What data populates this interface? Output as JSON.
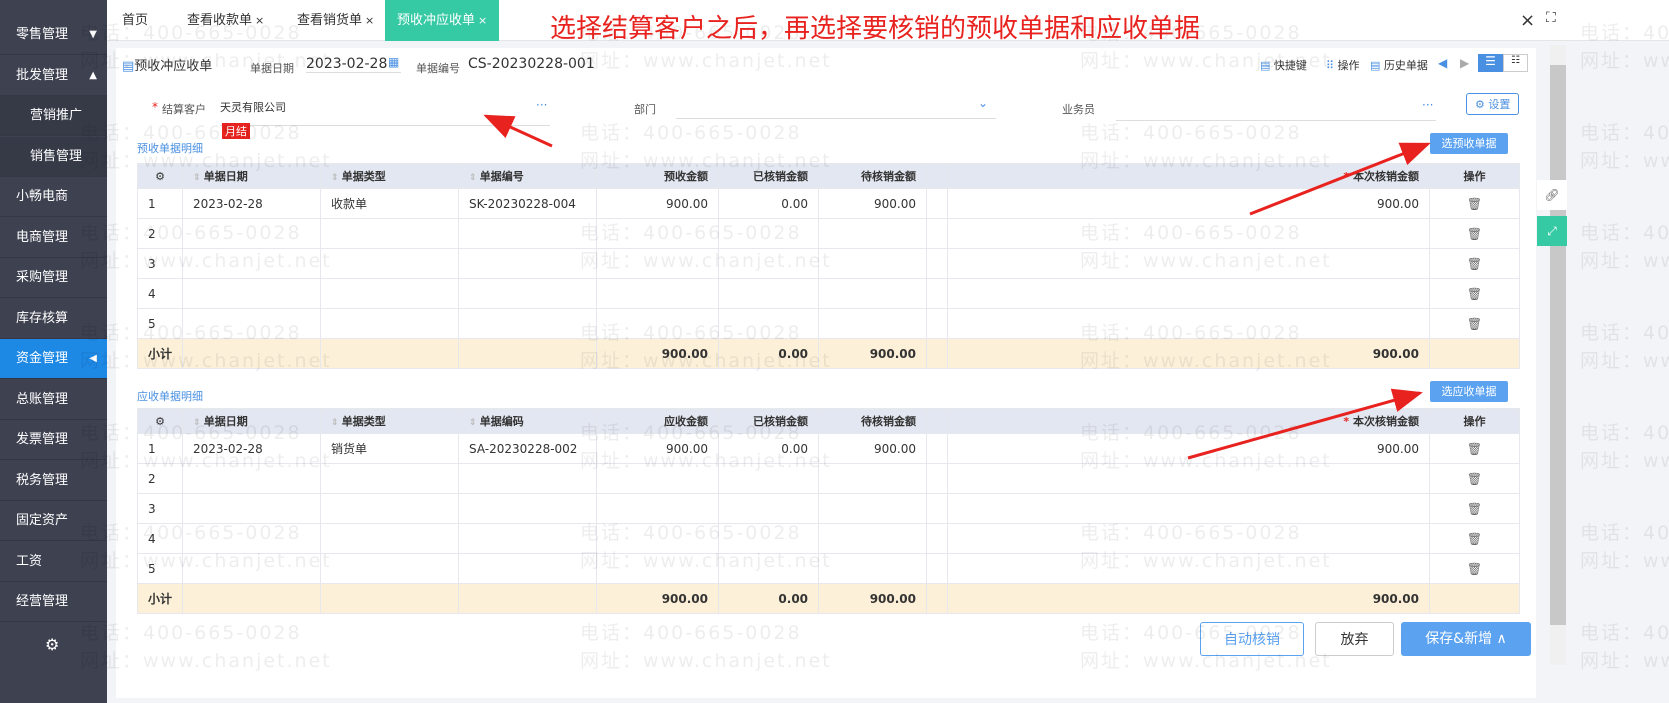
{
  "sidebar": {
    "items": [
      {
        "label": "零售管理",
        "arrow": "▼"
      },
      {
        "label": "批发管理",
        "arrow": "▲"
      },
      {
        "label": "营销推广",
        "sub": true
      },
      {
        "label": "销售管理",
        "sub": true
      },
      {
        "label": "小畅电商"
      },
      {
        "label": "电商管理"
      },
      {
        "label": "采购管理"
      },
      {
        "label": "库存核算"
      },
      {
        "label": "资金管理",
        "active": true,
        "arrow": "◀"
      },
      {
        "label": "总账管理"
      },
      {
        "label": "发票管理"
      },
      {
        "label": "税务管理"
      },
      {
        "label": "固定资产"
      },
      {
        "label": "工资"
      },
      {
        "label": "经营管理"
      }
    ],
    "settings_icon": "gear-icon"
  },
  "tabs": [
    {
      "label": "首页"
    },
    {
      "label": "查看收款单",
      "close": "×"
    },
    {
      "label": "查看销货单",
      "close": "×"
    },
    {
      "label": "预收冲应收单",
      "close": "×",
      "active": true
    }
  ],
  "annotation": "选择结算客户之后，再选择要核销的预收单据和应收单据",
  "window": {
    "close": "×",
    "fullscreen": "⛶"
  },
  "doc": {
    "tab_label": "预收冲应收单",
    "date_label": "单据日期",
    "date": "2023-02-28",
    "code_label": "单据编号",
    "code": "CS-20230228-001",
    "toolbar": {
      "shortcut": "快捷键",
      "ops": "操作",
      "history": "历史单据"
    },
    "customer_label": "结算客户",
    "customer": "天灵有限公司",
    "badge": "月结",
    "dept_label": "部门",
    "staff_label": "业务员",
    "settings": "设置",
    "more": "···"
  },
  "pre": {
    "title": "预收单据明细",
    "select_btn": "选预收单据",
    "headers": [
      "单据日期",
      "单据类型",
      "单据编号",
      "预收金额",
      "已核销金额",
      "待核销金额",
      "",
      "本次核销金额",
      "操作"
    ],
    "rows": [
      [
        "1",
        "2023-02-28",
        "收款单",
        "SK-20230228-004",
        "900.00",
        "0.00",
        "900.00",
        "",
        "900.00"
      ],
      [
        "2",
        "",
        "",
        "",
        "",
        "",
        "",
        "",
        ""
      ],
      [
        "3",
        "",
        "",
        "",
        "",
        "",
        "",
        "",
        ""
      ],
      [
        "4",
        "",
        "",
        "",
        "",
        "",
        "",
        "",
        ""
      ],
      [
        "5",
        "",
        "",
        "",
        "",
        "",
        "",
        "",
        ""
      ]
    ],
    "subtotal": [
      "小计",
      "",
      "",
      "",
      "900.00",
      "0.00",
      "900.00",
      "",
      "900.00"
    ]
  },
  "rec": {
    "title": "应收单据明细",
    "select_btn": "选应收单据",
    "headers": [
      "单据日期",
      "单据类型",
      "单据编码",
      "应收金额",
      "已核销金额",
      "待核销金额",
      "",
      "本次核销金额",
      "操作"
    ],
    "rows": [
      [
        "1",
        "2023-02-28",
        "销货单",
        "SA-20230228-002",
        "900.00",
        "0.00",
        "900.00",
        "",
        "900.00"
      ],
      [
        "2",
        "",
        "",
        "",
        "",
        "",
        "",
        "",
        ""
      ],
      [
        "3",
        "",
        "",
        "",
        "",
        "",
        "",
        "",
        ""
      ],
      [
        "4",
        "",
        "",
        "",
        "",
        "",
        "",
        "",
        ""
      ],
      [
        "5",
        "",
        "",
        "",
        "",
        "",
        "",
        "",
        ""
      ]
    ],
    "subtotal": [
      "小计",
      "",
      "",
      "",
      "900.00",
      "0.00",
      "900.00",
      "",
      "900.00"
    ]
  },
  "footer": {
    "auto": "自动核销",
    "discard": "放弃",
    "save": "保存&新增 ∧"
  },
  "watermark": {
    "phone": "电话：400-665-0028",
    "site": "网址：www.chanjet.net"
  },
  "colors": {
    "accent": "#5ba2f0",
    "active_tab": "#35c9a4",
    "sidebar": "#3d4150",
    "annotation": "#e8231f"
  }
}
